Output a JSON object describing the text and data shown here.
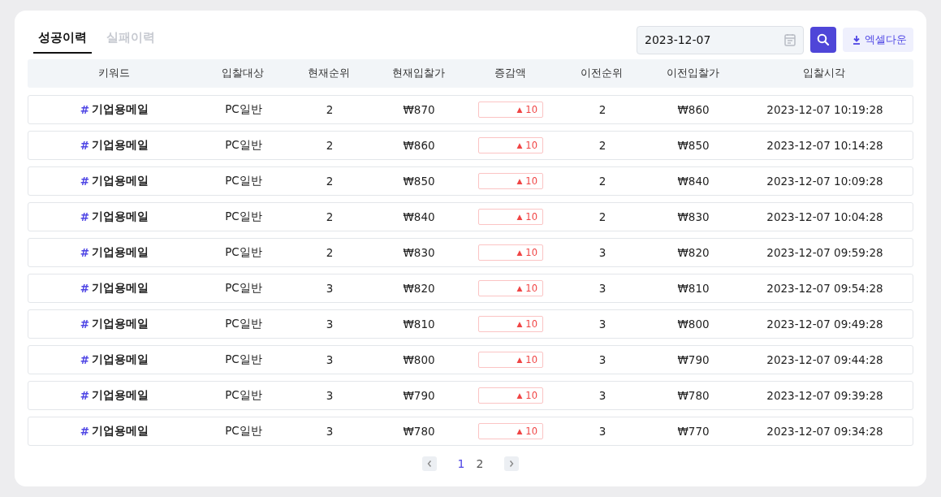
{
  "tabs": [
    {
      "label": "성공이력",
      "selected": true
    },
    {
      "label": "실패이력",
      "selected": false
    }
  ],
  "date_field": {
    "value": "2023-12-07"
  },
  "excel_button": {
    "label": "엑셀다운"
  },
  "table": {
    "columns": [
      "키워드",
      "입찰대상",
      "현재순위",
      "현재입찰가",
      "증감액",
      "이전순위",
      "이전입찰가",
      "입찰시각"
    ],
    "rows": [
      {
        "hash": "#",
        "keyword": "기업용메일",
        "target": "PC일반",
        "rank": "2",
        "bid": "₩870",
        "arrow": "▲",
        "delta": "10",
        "prev_rank": "2",
        "prev_bid": "₩860",
        "time": "2023-12-07 10:19:28"
      },
      {
        "hash": "#",
        "keyword": "기업용메일",
        "target": "PC일반",
        "rank": "2",
        "bid": "₩860",
        "arrow": "▲",
        "delta": "10",
        "prev_rank": "2",
        "prev_bid": "₩850",
        "time": "2023-12-07 10:14:28"
      },
      {
        "hash": "#",
        "keyword": "기업용메일",
        "target": "PC일반",
        "rank": "2",
        "bid": "₩850",
        "arrow": "▲",
        "delta": "10",
        "prev_rank": "2",
        "prev_bid": "₩840",
        "time": "2023-12-07 10:09:28"
      },
      {
        "hash": "#",
        "keyword": "기업용메일",
        "target": "PC일반",
        "rank": "2",
        "bid": "₩840",
        "arrow": "▲",
        "delta": "10",
        "prev_rank": "2",
        "prev_bid": "₩830",
        "time": "2023-12-07 10:04:28"
      },
      {
        "hash": "#",
        "keyword": "기업용메일",
        "target": "PC일반",
        "rank": "2",
        "bid": "₩830",
        "arrow": "▲",
        "delta": "10",
        "prev_rank": "3",
        "prev_bid": "₩820",
        "time": "2023-12-07 09:59:28"
      },
      {
        "hash": "#",
        "keyword": "기업용메일",
        "target": "PC일반",
        "rank": "3",
        "bid": "₩820",
        "arrow": "▲",
        "delta": "10",
        "prev_rank": "3",
        "prev_bid": "₩810",
        "time": "2023-12-07 09:54:28"
      },
      {
        "hash": "#",
        "keyword": "기업용메일",
        "target": "PC일반",
        "rank": "3",
        "bid": "₩810",
        "arrow": "▲",
        "delta": "10",
        "prev_rank": "3",
        "prev_bid": "₩800",
        "time": "2023-12-07 09:49:28"
      },
      {
        "hash": "#",
        "keyword": "기업용메일",
        "target": "PC일반",
        "rank": "3",
        "bid": "₩800",
        "arrow": "▲",
        "delta": "10",
        "prev_rank": "3",
        "prev_bid": "₩790",
        "time": "2023-12-07 09:44:28"
      },
      {
        "hash": "#",
        "keyword": "기업용메일",
        "target": "PC일반",
        "rank": "3",
        "bid": "₩790",
        "arrow": "▲",
        "delta": "10",
        "prev_rank": "3",
        "prev_bid": "₩780",
        "time": "2023-12-07 09:39:28"
      },
      {
        "hash": "#",
        "keyword": "기업용메일",
        "target": "PC일반",
        "rank": "3",
        "bid": "₩780",
        "arrow": "▲",
        "delta": "10",
        "prev_rank": "3",
        "prev_bid": "₩770",
        "time": "2023-12-07 09:34:28"
      }
    ]
  },
  "pagination": {
    "pages": [
      {
        "label": "1",
        "selected": true
      },
      {
        "label": "2",
        "selected": false
      }
    ]
  }
}
